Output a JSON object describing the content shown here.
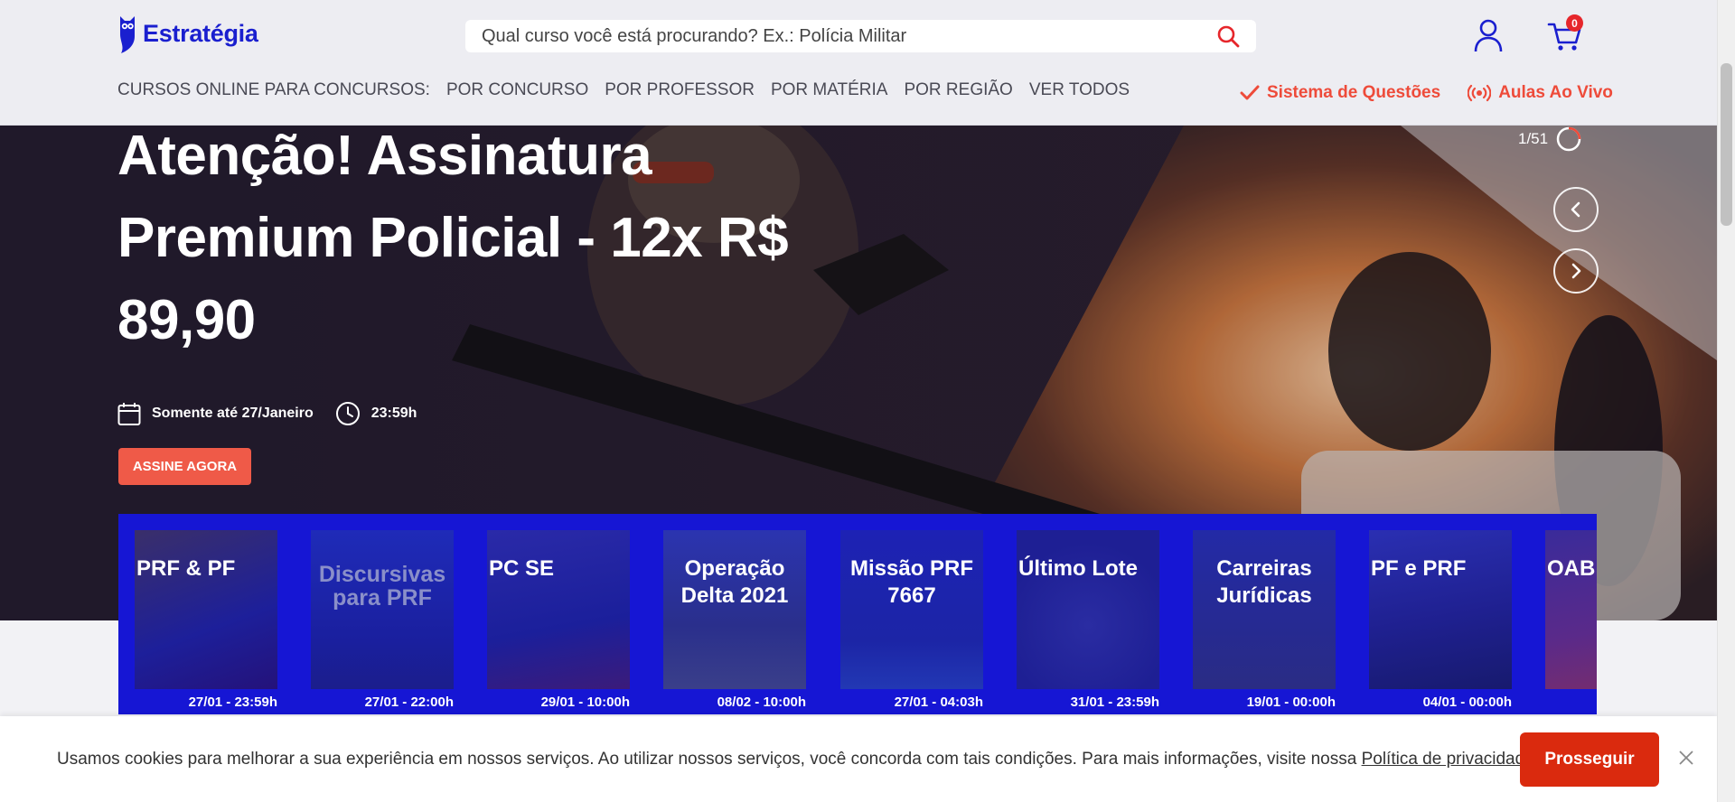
{
  "header": {
    "logo_text": "Estratégia",
    "search_placeholder": "Qual curso você está procurando? Ex.: Polícia Militar",
    "cart_count": "0"
  },
  "nav": {
    "items": [
      "CURSOS ONLINE PARA CONCURSOS:",
      "POR CONCURSO",
      "POR PROFESSOR",
      "POR MATÉRIA",
      "POR REGIÃO",
      "VER TODOS"
    ],
    "questions_label": "Sistema de Questões",
    "live_label": "Aulas Ao Vivo"
  },
  "hero": {
    "title": "Atenção! Assinatura Premium Policial - 12x R$ 89,90",
    "deadline": "Somente até 27/Janeiro",
    "time": "23:59h",
    "cta_label": "ASSINE AGORA",
    "slide_counter": "1/51"
  },
  "promo": {
    "cards": [
      {
        "title": "PRF & PF",
        "date": "27/01 - 23:59h"
      },
      {
        "title": "Discursivas para PRF",
        "date": "27/01 - 22:00h"
      },
      {
        "title": "PC SE",
        "date": "29/01 - 10:00h"
      },
      {
        "title": "Operação Delta 2021",
        "date": "08/02 - 10:00h"
      },
      {
        "title": "Missão PRF 7667",
        "date": "27/01 - 04:03h"
      },
      {
        "title": "Último Lote",
        "date": "31/01 - 23:59h"
      },
      {
        "title": "Carreiras Jurídicas",
        "date": "19/01 - 00:00h"
      },
      {
        "title": "PF e PRF",
        "date": "04/01 - 00:00h"
      },
      {
        "title": "OAB",
        "date": ""
      }
    ]
  },
  "cookie": {
    "text": "Usamos cookies para melhorar a sua experiência em nossos serviços. Ao utilizar nossos serviços, você concorda com tais condições. Para mais informações, visite nossa ",
    "link_text": "Política de privacidade",
    "text_end": ".",
    "button_label": "Prosseguir"
  },
  "colors": {
    "brand_blue": "#1a1fcf",
    "accent_red": "#ee4b3a",
    "promo_blue": "#1616d4"
  }
}
